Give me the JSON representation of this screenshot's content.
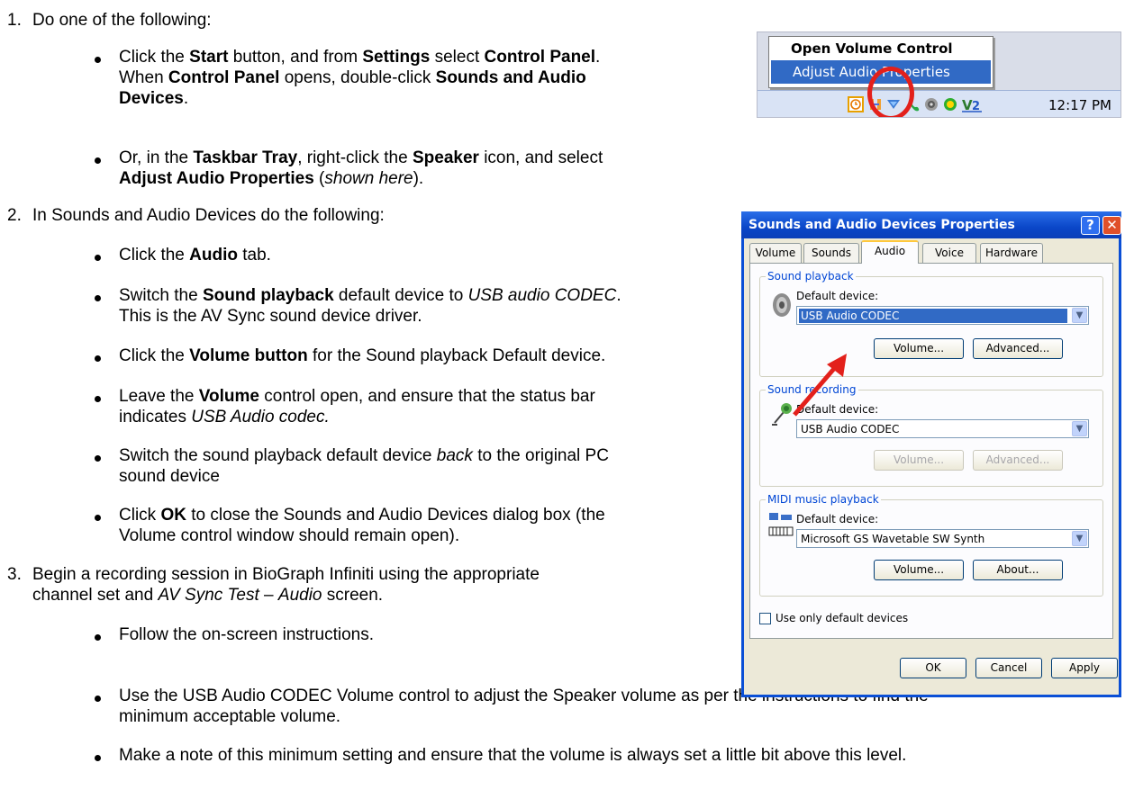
{
  "steps": [
    {
      "number": "1.",
      "text": "Do one of the following:",
      "bullets": [
        [
          {
            "t": "Click the "
          },
          {
            "t": "Start",
            "b": true
          },
          {
            "t": " button, and from "
          },
          {
            "t": "Settings",
            "b": true
          },
          {
            "t": " select "
          },
          {
            "t": "Control Panel",
            "b": true
          },
          {
            "t": "."
          },
          {
            "br": true
          },
          {
            "t": "When "
          },
          {
            "t": "Control Panel",
            "b": true
          },
          {
            "t": " opens, double-click "
          },
          {
            "t": "Sounds and Audio",
            "b": true
          },
          {
            "br": true
          },
          {
            "t": "Devices",
            "b": true
          },
          {
            "t": "."
          }
        ],
        [
          {
            "t": "Or, in the "
          },
          {
            "t": "Taskbar Tray",
            "b": true
          },
          {
            "t": ", right-click the "
          },
          {
            "t": "Speaker",
            "b": true
          },
          {
            "t": " icon, and select"
          },
          {
            "br": true
          },
          {
            "t": "Adjust Audio Properties",
            "b": true
          },
          {
            "t": " ("
          },
          {
            "t": "shown here",
            "i": true
          },
          {
            "t": ")."
          }
        ]
      ]
    },
    {
      "number": "2.",
      "text": "In Sounds and Audio Devices do the following:",
      "bullets": [
        [
          {
            "t": "Click the "
          },
          {
            "t": "Audio",
            "b": true
          },
          {
            "t": " tab."
          }
        ],
        [
          {
            "t": "Switch the "
          },
          {
            "t": "Sound playback",
            "b": true
          },
          {
            "t": " default device to "
          },
          {
            "t": "USB audio CODEC",
            "i": true
          },
          {
            "t": "."
          },
          {
            "br": true
          },
          {
            "t": "This is the AV Sync sound device driver."
          }
        ],
        [
          {
            "t": "Click the "
          },
          {
            "t": "Volume button",
            "b": true
          },
          {
            "t": " for the Sound playback Default device."
          }
        ],
        [
          {
            "t": "Leave the "
          },
          {
            "t": "Volume",
            "b": true
          },
          {
            "t": " control open, and ensure that the status bar"
          },
          {
            "br": true
          },
          {
            "t": "indicates "
          },
          {
            "t": "USB Audio codec.",
            "i": true
          }
        ],
        [
          {
            "t": "Switch the sound playback default device "
          },
          {
            "t": "back",
            "i": true
          },
          {
            "t": " to the original PC"
          },
          {
            "br": true
          },
          {
            "t": "sound device"
          }
        ],
        [
          {
            "t": "Click "
          },
          {
            "t": "OK",
            "b": true
          },
          {
            "t": " to close the Sounds and Audio Devices dialog box (the"
          },
          {
            "br": true
          },
          {
            "t": "Volume control window should remain open)."
          }
        ]
      ]
    },
    {
      "number": "3.",
      "text_runs": [
        {
          "t": "Begin a recording session in BioGraph Infiniti using the appropriate"
        },
        {
          "br": true
        },
        {
          "t": "channel set and "
        },
        {
          "t": "AV Sync Test",
          "i": true
        },
        {
          "t": " – "
        },
        {
          "t": "Audio",
          "i": true
        },
        {
          "t": " screen."
        }
      ],
      "bullets": [
        [
          {
            "t": "Follow the on-screen instructions."
          }
        ],
        [
          {
            "t": "Use the USB Audio CODEC Volume control to adjust the Speaker volume as per the instructions to find the"
          },
          {
            "br": true
          },
          {
            "t": "minimum acceptable volume."
          }
        ],
        [
          {
            "t": "Make a note of this minimum setting and ensure that the volume is always set a little bit above this level."
          }
        ]
      ]
    }
  ],
  "tray_figure": {
    "menu_items": [
      "Open Volume Control",
      "Adjust Audio Properties"
    ],
    "clock": "12:17 PM",
    "highlight_color": "#e3201b"
  },
  "dialog": {
    "title": "Sounds and Audio Devices Properties",
    "help_glyph": "?",
    "close_glyph": "✕",
    "tabs": [
      "Volume",
      "Sounds",
      "Audio",
      "Voice",
      "Hardware"
    ],
    "active_tab": "Audio",
    "playback": {
      "group_label": "Sound playback",
      "default_label": "Default device:",
      "device": "USB Audio CODEC",
      "volume_button": "Volume...",
      "advanced_button": "Advanced..."
    },
    "recording": {
      "group_label": "Sound recording",
      "default_label": "Default device:",
      "device": "USB Audio CODEC",
      "volume_button": "Volume...",
      "advanced_button": "Advanced..."
    },
    "midi": {
      "group_label": "MIDI music playback",
      "default_label": "Default device:",
      "device": "Microsoft GS Wavetable SW Synth",
      "volume_button": "Volume...",
      "about_button": "About..."
    },
    "use_default_label": "Use only default devices",
    "buttons": {
      "ok": "OK",
      "cancel": "Cancel",
      "apply": "Apply"
    },
    "arrow_color": "#e3201b"
  }
}
